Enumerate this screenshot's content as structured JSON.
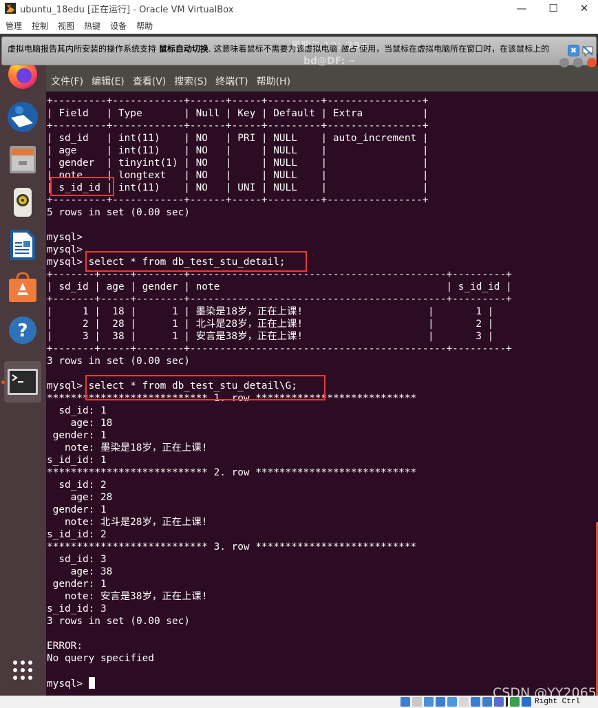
{
  "host_window": {
    "title": "ubuntu_18edu [正在运行] - Oracle VM VirtualBox",
    "controls": {
      "minimize": "—",
      "maximize": "☐",
      "close": "✕"
    },
    "menu": [
      "管理",
      "控制",
      "视图",
      "热键",
      "设备",
      "帮助"
    ]
  },
  "notification": {
    "text_before": "虚拟电脑报告其内所安装的操作系统支持 ",
    "text_bold": "鼠标自动切换",
    "text_middle": ". 这意味着鼠标不需要为该虚拟电脑 ",
    "text_italic": "独占",
    "text_after": " 使用，当鼠标在虚拟电脑所在窗口时，在该鼠标上的",
    "close_icon": "✖",
    "ghost_clock": "星期二 10：20●",
    "ghost_terminal_title": "bd@DF: ~"
  },
  "dock": {
    "items": [
      {
        "name": "firefox"
      },
      {
        "name": "thunderbird"
      },
      {
        "name": "files"
      },
      {
        "name": "rhythmbox"
      },
      {
        "name": "libreoffice-writer"
      },
      {
        "name": "ubuntu-software"
      },
      {
        "name": "help"
      },
      {
        "name": "terminal",
        "active": true
      }
    ],
    "show_apps_label": "⋮⋮⋮"
  },
  "terminal": {
    "menu": [
      "文件(F)",
      "编辑(E)",
      "查看(V)",
      "搜索(S)",
      "终端(T)",
      "帮助(H)"
    ],
    "lines": [
      "+---------+------------+------+-----+---------+----------------+",
      "| Field   | Type       | Null | Key | Default | Extra          |",
      "+---------+------------+------+-----+---------+----------------+",
      "| sd_id   | int(11)    | NO   | PRI | NULL    | auto_increment |",
      "| age     | int(11)    | NO   |     | NULL    |                |",
      "| gender  | tinyint(1) | NO   |     | NULL    |                |",
      "| note    | longtext   | NO   |     | NULL    |                |",
      "| s_id_id | int(11)    | NO   | UNI | NULL    |                |",
      "+---------+------------+------+-----+---------+----------------+",
      "5 rows in set (0.00 sec)",
      "",
      "mysql>",
      "mysql>",
      "mysql> select * from db_test_stu_detail;",
      "+-------+-----+--------+-------------------------------------------+---------+",
      "| sd_id | age | gender | note                                      | s_id_id |",
      "+-------+-----+--------+-------------------------------------------+---------+",
      "|     1 |  18 |      1 | 墨染是18岁，正在上课!                     |       1 |",
      "|     2 |  28 |      1 | 北斗是28岁，正在上课!                     |       2 |",
      "|     3 |  38 |      1 | 安言是38岁，正在上课!                     |       3 |",
      "+-------+-----+--------+-------------------------------------------+---------+",
      "3 rows in set (0.00 sec)",
      "",
      "mysql> select * from db_test_stu_detail\\G;",
      "*************************** 1. row ***************************",
      "  sd_id: 1",
      "    age: 18",
      " gender: 1",
      "   note: 墨染是18岁，正在上课!",
      "s_id_id: 1",
      "*************************** 2. row ***************************",
      "  sd_id: 2",
      "    age: 28",
      " gender: 1",
      "   note: 北斗是28岁，正在上课!",
      "s_id_id: 2",
      "*************************** 3. row ***************************",
      "  sd_id: 3",
      "    age: 38",
      " gender: 1",
      "   note: 安言是38岁，正在上课!",
      "s_id_id: 3",
      "3 rows in set (0.00 sec)",
      "",
      "ERROR:",
      "No query specified",
      "",
      "mysql> "
    ],
    "highlights": [
      {
        "label": "s_id_id field"
      },
      {
        "label": "select * from db_test_stu_detail;"
      },
      {
        "label": "select * from db_test_stu_detail\\G;"
      }
    ]
  },
  "statusbar": {
    "host_key": "Right Ctrl",
    "icons": [
      "hard-disk",
      "optical-drive",
      "audio",
      "network",
      "usb",
      "shared-folders",
      "display",
      "capture",
      "vrde",
      "recording",
      "cpu",
      "mouse-integration"
    ]
  },
  "watermark": "CSDN @YY2065"
}
